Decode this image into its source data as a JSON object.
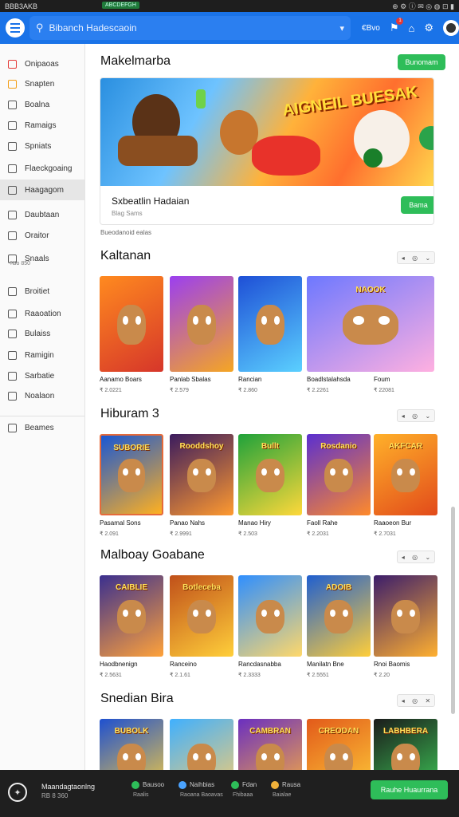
{
  "status_bar": {
    "time": "BBB3AKB",
    "pill": "ABCDEFGH",
    "icons": "⊕ ⚙ ⓘ ✉ ◎ ◍ ⊡ ▮"
  },
  "topbar": {
    "search_placeholder": "Bibanch Hadescaoin",
    "lang": "€Bvo"
  },
  "notification_badge": "1",
  "sidebar": {
    "items": [
      {
        "label": "Onipaoas",
        "color": "#e53935"
      },
      {
        "label": "Snapten",
        "color": "#f39c12"
      },
      {
        "label": "Boalna",
        "color": "#555"
      },
      {
        "label": "Ramaigs",
        "color": "#555"
      },
      {
        "label": "Spniats",
        "color": "#555"
      },
      {
        "label": "Flaeckgoaing",
        "color": "#555"
      },
      {
        "label": "Haagagom",
        "color": "#555"
      },
      {
        "label": "Daubtaan",
        "color": "#555"
      },
      {
        "label": "Oraitor",
        "color": "#555"
      },
      {
        "label": "Snaals",
        "color": "#555"
      },
      {
        "label": "Broitiet",
        "color": "#555"
      },
      {
        "label": "Raaoation",
        "color": "#555"
      },
      {
        "label": "Bulaiss",
        "color": "#555"
      },
      {
        "label": "Ramigin",
        "color": "#555"
      },
      {
        "label": "Sarbatie",
        "color": "#555"
      },
      {
        "label": "Noalaon",
        "color": "#555"
      },
      {
        "label": "Beames",
        "color": "#555"
      }
    ],
    "snaals_sub": "?Bo 850"
  },
  "featured": {
    "title": "Makelmarba",
    "button": "Bunomam",
    "hero_text": "AIGNEIL BUESAK",
    "game_name": "Sxbeatlin Hadaian",
    "game_sub": "Blag Sams",
    "game_button": "Bama",
    "caption": "Bueodanoid ealas"
  },
  "sections": [
    {
      "title": "Kaltanan",
      "controls": [
        "◂",
        "◎",
        "⌄"
      ],
      "tiles": [
        {
          "name": "Aanamo Boars",
          "sub": "₹ 2.0221",
          "colors": [
            "#ff8a1f",
            "#d6362a"
          ]
        },
        {
          "name": "Panlab Sbalas",
          "sub": "₹ 2.579",
          "colors": [
            "#9b3ff0",
            "#f5a623"
          ]
        },
        {
          "name": "Rancian",
          "sub": "₹ 2.860",
          "colors": [
            "#1e4fd6",
            "#5bd0ff"
          ]
        },
        {
          "name": "Boadlstalahsda",
          "sub": "₹ 2.2261",
          "colors": [
            "#6d78ff",
            "#ffb0e0"
          ],
          "logo": "NAOOK"
        },
        {
          "name": "Foum",
          "sub": "₹ 22081",
          "colors": [
            "#7a8cff",
            "#ff7ad6"
          ]
        }
      ]
    },
    {
      "title": "Hiburam 3",
      "controls": [
        "◂",
        "◎",
        "⌄"
      ],
      "tiles": [
        {
          "name": "Pasamal Sons",
          "sub": "₹ 2.091",
          "colors": [
            "#1857d4",
            "#ffb020"
          ],
          "logo": "SUBORIE"
        },
        {
          "name": "Panao Nahs",
          "sub": "₹ 2.9991",
          "colors": [
            "#3a1b5e",
            "#ff9a2f"
          ],
          "logo": "Rooddshoy"
        },
        {
          "name": "Manao Hiry",
          "sub": "₹ 2.503",
          "colors": [
            "#1fa23a",
            "#ffd83a"
          ],
          "logo": "Bullt"
        },
        {
          "name": "Faoll Rahe",
          "sub": "₹ 2.2031",
          "colors": [
            "#5a2fd0",
            "#ff8a2a"
          ],
          "logo": "Rosdanio"
        },
        {
          "name": "Raaoeon Bur",
          "sub": "₹ 2.7031",
          "colors": [
            "#ffb12a",
            "#e24a1a"
          ],
          "logo": "AKFCAR"
        }
      ]
    },
    {
      "title": "Malboay Goabane",
      "controls": [
        "◂",
        "◎",
        "⌄"
      ],
      "tiles": [
        {
          "name": "Haodbnenign",
          "sub": "₹ 2.5631",
          "colors": [
            "#3a2f8f",
            "#ffa23a"
          ],
          "logo": "CAIBLIE"
        },
        {
          "name": "Ranceino",
          "sub": "₹ 2.1.61",
          "colors": [
            "#c0501a",
            "#ffcf3a"
          ],
          "logo": "Botleceba"
        },
        {
          "name": "Rancdasnabba",
          "sub": "₹ 2.3333",
          "colors": [
            "#2f8fff",
            "#ffd86a"
          ]
        },
        {
          "name": "Manilatn Bne",
          "sub": "₹ 2.5551",
          "colors": [
            "#1f5fd0",
            "#ffce3a"
          ],
          "logo": "ADOIB"
        },
        {
          "name": "Rnoi Baomis",
          "sub": "₹ 2.20",
          "colors": [
            "#3b1d6b",
            "#ffb030"
          ]
        }
      ]
    },
    {
      "title": "Snedian Bira",
      "controls": [
        "◂",
        "◎",
        "✕"
      ],
      "tiles": [
        {
          "name": "",
          "sub": "",
          "colors": [
            "#1e50d0",
            "#ffd23a"
          ],
          "logo": "BUBOLK"
        },
        {
          "name": "",
          "sub": "",
          "colors": [
            "#3fb0ff",
            "#ffce6a"
          ]
        },
        {
          "name": "",
          "sub": "",
          "colors": [
            "#6a2fc0",
            "#ffb33a"
          ],
          "logo": "CAMBRAN"
        },
        {
          "name": "",
          "sub": "",
          "colors": [
            "#e25a1a",
            "#ffd03a"
          ],
          "logo": "CREODAN"
        },
        {
          "name": "",
          "sub": "",
          "colors": [
            "#1b1b1b",
            "#3fd05a"
          ],
          "logo": "LABHBERA"
        }
      ]
    }
  ],
  "bottom_bar": {
    "title": "Maandagtaonlng",
    "subtitle": "RB 8 360",
    "items": [
      {
        "top": "Bausoo",
        "bottom": "Raalis",
        "color": "#2ebd59"
      },
      {
        "top": "Naihbias",
        "bottom": "Raoana Baoavas",
        "color": "#4aa3ff"
      },
      {
        "top": "Fdan",
        "bottom": "Fhibaaa",
        "color": "#2ebd59"
      },
      {
        "top": "Rausa",
        "bottom": "Baialae",
        "color": "#f0b13a"
      }
    ],
    "button": "Rauhe Huaurrana"
  }
}
